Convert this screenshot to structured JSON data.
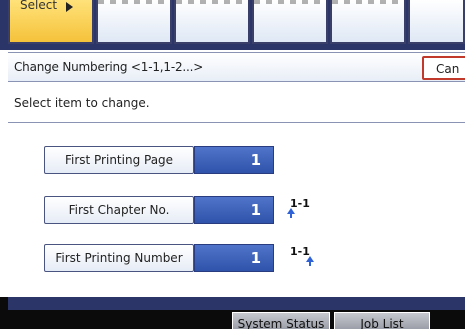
{
  "top_tabs": {
    "selected_label": "Select"
  },
  "header": {
    "title": "Change Numbering <1-1,1-2...>",
    "cancel_label": "Can"
  },
  "instruction": "Select item to change.",
  "rows": [
    {
      "label": "First Printing Page",
      "value": "1"
    },
    {
      "label": "First Chapter No.",
      "value": "1"
    },
    {
      "label": "First Printing Number",
      "value": "1"
    }
  ],
  "markers": {
    "chapter": "1-1",
    "number": "1-1"
  },
  "bottom": {
    "system_status": "System Status",
    "job_list": "Job List"
  },
  "colors": {
    "accent_yellow": "#f5c23a",
    "value_blue": "#2f53aa",
    "frame_navy": "#2c3568",
    "cancel_red": "#c0392b"
  }
}
